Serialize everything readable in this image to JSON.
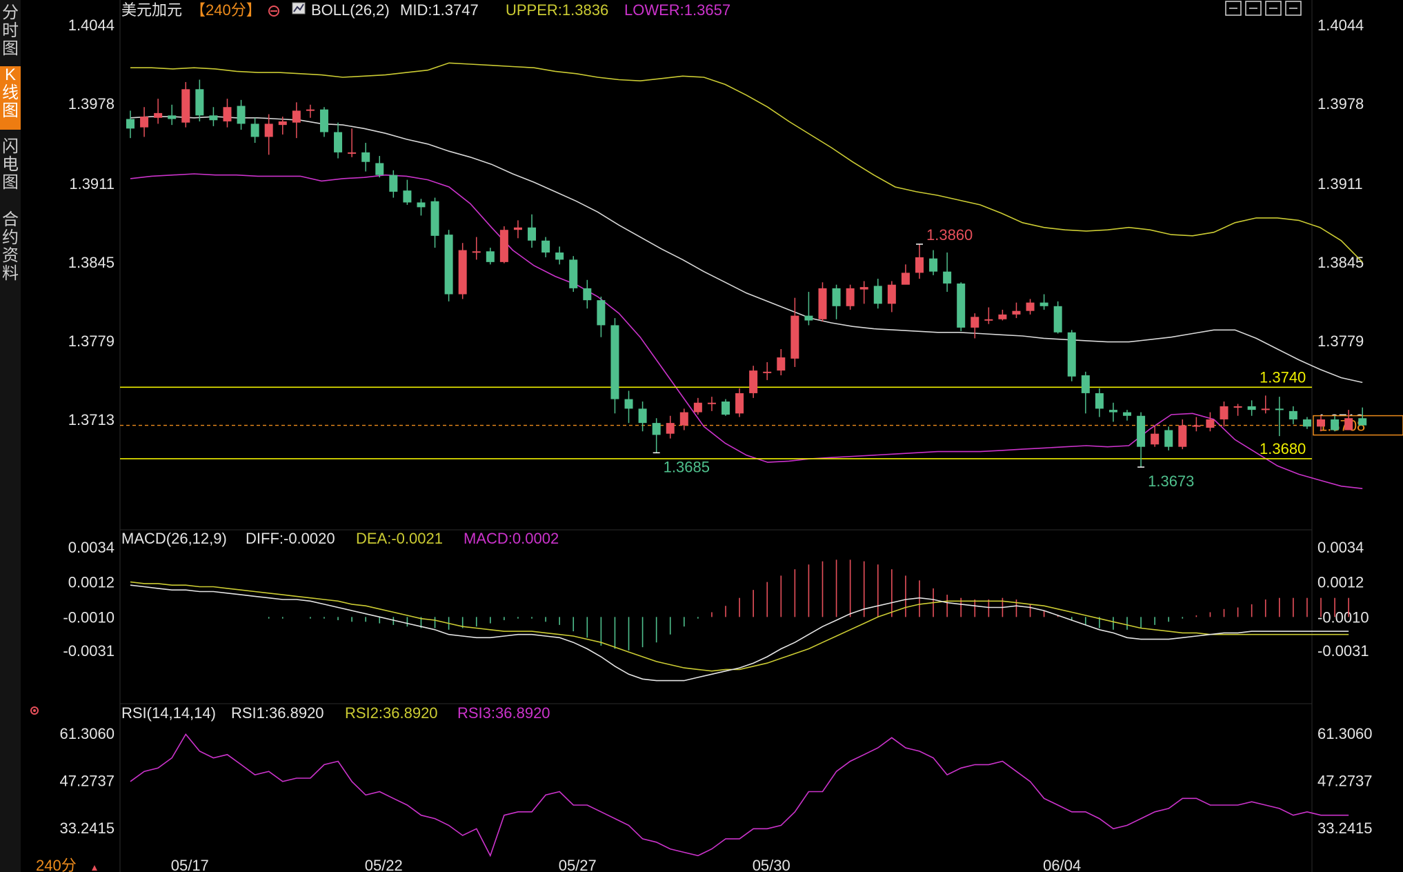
{
  "sidebar": {
    "tabs": [
      {
        "label": "分\n时\n图",
        "active": false
      },
      {
        "label": "K\n线\n图",
        "active": true
      },
      {
        "label": "闪\n电\n图",
        "active": false
      },
      {
        "label": "合\n约\n资\n料",
        "active": false
      }
    ]
  },
  "period_footer": "240分",
  "colors": {
    "up": "#e8505b",
    "down": "#4fc08d",
    "mid": "#d9d9d9",
    "upper": "#cccc33",
    "lower": "#cc33cc",
    "level": "#f0f000",
    "current": "#ee8c1c"
  },
  "toolbar_icons": [
    "fullscreen-icon",
    "layout-icon",
    "split-icon",
    "close-icon"
  ],
  "chart_data": [
    {
      "type": "candlestick",
      "symbol": "美元加元",
      "period": "【240分】",
      "indicator": "BOLL(26,2)",
      "legend": {
        "mid": "MID:1.3747",
        "upper": "UPPER:1.3836",
        "lower": "LOWER:1.3657"
      },
      "ylim": [
        1.3625,
        1.4044
      ],
      "y_ticks": [
        "1.4044",
        "1.3978",
        "1.3911",
        "1.3845",
        "1.3779",
        "1.3713"
      ],
      "x_ticks": [
        "05/17",
        "05/22",
        "05/27",
        "05/30",
        "06/04"
      ],
      "candles": [
        [
          1.3965,
          1.3957,
          1.3972,
          1.3949
        ],
        [
          1.3958,
          1.3967,
          1.3975,
          1.395
        ],
        [
          1.3966,
          1.397,
          1.3982,
          1.3961
        ],
        [
          1.3968,
          1.3965,
          1.3977,
          1.396
        ],
        [
          1.3962,
          1.399,
          1.3996,
          1.3958
        ],
        [
          1.399,
          1.3968,
          1.3998,
          1.3963
        ],
        [
          1.3968,
          1.3964,
          1.3975,
          1.3959
        ],
        [
          1.3963,
          1.3975,
          1.3982,
          1.3958
        ],
        [
          1.3976,
          1.3961,
          1.3981,
          1.3956
        ],
        [
          1.3961,
          1.395,
          1.3966,
          1.3945
        ],
        [
          1.395,
          1.3961,
          1.3969,
          1.3935
        ],
        [
          1.396,
          1.3963,
          1.3967,
          1.3952
        ],
        [
          1.3962,
          1.3972,
          1.3979,
          1.3949
        ],
        [
          1.3973,
          1.3973,
          1.3977,
          1.3966
        ],
        [
          1.3973,
          1.3954,
          1.3975,
          1.395
        ],
        [
          1.3954,
          1.3937,
          1.3962,
          1.3932
        ],
        [
          1.3937,
          1.3937,
          1.3957,
          1.3933
        ],
        [
          1.3937,
          1.3929,
          1.3945,
          1.3921
        ],
        [
          1.3928,
          1.3918,
          1.3934,
          1.3916
        ],
        [
          1.3918,
          1.3904,
          1.3922,
          1.3899
        ],
        [
          1.3905,
          1.3895,
          1.3914,
          1.3893
        ],
        [
          1.3895,
          1.3891,
          1.3898,
          1.3884
        ],
        [
          1.3896,
          1.3867,
          1.3899,
          1.3857
        ],
        [
          1.3868,
          1.3818,
          1.3872,
          1.3812
        ],
        [
          1.3818,
          1.3855,
          1.3861,
          1.3814
        ],
        [
          1.3854,
          1.3854,
          1.3866,
          1.3847
        ],
        [
          1.3854,
          1.3845,
          1.3857,
          1.3843
        ],
        [
          1.3845,
          1.3872,
          1.3875,
          1.3844
        ],
        [
          1.3872,
          1.3874,
          1.388,
          1.3865
        ],
        [
          1.3874,
          1.3863,
          1.3885,
          1.3857
        ],
        [
          1.3863,
          1.3853,
          1.3866,
          1.3849
        ],
        [
          1.3853,
          1.3847,
          1.3858,
          1.3843
        ],
        [
          1.3847,
          1.3823,
          1.385,
          1.382
        ],
        [
          1.3823,
          1.3813,
          1.383,
          1.3806
        ],
        [
          1.3813,
          1.3792,
          1.3816,
          1.3782
        ],
        [
          1.3792,
          1.373,
          1.3798,
          1.3718
        ],
        [
          1.373,
          1.3722,
          1.3737,
          1.371
        ],
        [
          1.3722,
          1.371,
          1.3728,
          1.3703
        ],
        [
          1.371,
          1.37,
          1.3714,
          1.3685
        ],
        [
          1.3701,
          1.371,
          1.3716,
          1.3697
        ],
        [
          1.3708,
          1.3719,
          1.3722,
          1.3704
        ],
        [
          1.3719,
          1.3727,
          1.3731,
          1.3717
        ],
        [
          1.3726,
          1.3727,
          1.3732,
          1.372
        ],
        [
          1.3728,
          1.3717,
          1.373,
          1.3716
        ],
        [
          1.3718,
          1.3735,
          1.3739,
          1.3715
        ],
        [
          1.3735,
          1.3754,
          1.3758,
          1.3731
        ],
        [
          1.3752,
          1.3753,
          1.3761,
          1.3746
        ],
        [
          1.3754,
          1.3765,
          1.3772,
          1.375
        ],
        [
          1.3764,
          1.38,
          1.3815,
          1.3757
        ],
        [
          1.38,
          1.3796,
          1.382,
          1.3792
        ],
        [
          1.3797,
          1.3823,
          1.3828,
          1.3795
        ],
        [
          1.3823,
          1.3808,
          1.3826,
          1.3797
        ],
        [
          1.3808,
          1.3823,
          1.3826,
          1.3805
        ],
        [
          1.3822,
          1.3824,
          1.3829,
          1.381
        ],
        [
          1.3825,
          1.381,
          1.3831,
          1.3806
        ],
        [
          1.381,
          1.3826,
          1.3829,
          1.3803
        ],
        [
          1.3826,
          1.3836,
          1.3843,
          1.3831
        ],
        [
          1.3836,
          1.3849,
          1.386,
          1.3831
        ],
        [
          1.3848,
          1.3837,
          1.3855,
          1.3834
        ],
        [
          1.3837,
          1.3827,
          1.3853,
          1.382
        ],
        [
          1.3827,
          1.379,
          1.3828,
          1.3787
        ],
        [
          1.379,
          1.3799,
          1.3802,
          1.3781
        ],
        [
          1.3797,
          1.3797,
          1.3807,
          1.3793
        ],
        [
          1.3797,
          1.3801,
          1.3805,
          1.3796
        ],
        [
          1.3801,
          1.3804,
          1.3811,
          1.3798
        ],
        [
          1.3804,
          1.3811,
          1.3814,
          1.3801
        ],
        [
          1.3811,
          1.3808,
          1.3818,
          1.3805
        ],
        [
          1.3808,
          1.3786,
          1.3812,
          1.3785
        ],
        [
          1.3786,
          1.3749,
          1.3788,
          1.3745
        ],
        [
          1.375,
          1.3735,
          1.3753,
          1.3718
        ],
        [
          1.3735,
          1.3722,
          1.3739,
          1.3715
        ],
        [
          1.3721,
          1.3719,
          1.3727,
          1.3711
        ],
        [
          1.3719,
          1.3716,
          1.3721,
          1.3712
        ],
        [
          1.3716,
          1.369,
          1.3719,
          1.3673
        ],
        [
          1.3692,
          1.3701,
          1.3708,
          1.369
        ],
        [
          1.3704,
          1.369,
          1.3707,
          1.3687
        ],
        [
          1.369,
          1.3708,
          1.3713,
          1.3688
        ],
        [
          1.3708,
          1.3708,
          1.3715,
          1.3703
        ],
        [
          1.3706,
          1.3713,
          1.3719,
          1.3703
        ],
        [
          1.3713,
          1.3724,
          1.3728,
          1.3707
        ],
        [
          1.3724,
          1.3724,
          1.3726,
          1.3716
        ],
        [
          1.3724,
          1.3721,
          1.3729,
          1.3716
        ],
        [
          1.3722,
          1.3722,
          1.3733,
          1.3718
        ],
        [
          1.3722,
          1.3721,
          1.3732,
          1.3699
        ],
        [
          1.372,
          1.3713,
          1.3724,
          1.3709
        ],
        [
          1.3713,
          1.3707,
          1.3715,
          1.3705
        ],
        [
          1.3707,
          1.3713,
          1.3716,
          1.3703
        ],
        [
          1.3713,
          1.3704,
          1.3716,
          1.3703
        ],
        [
          1.3704,
          1.3714,
          1.3721,
          1.3705
        ],
        [
          1.3714,
          1.3708,
          1.3723,
          1.3708
        ]
      ],
      "mid": [
        1.3966,
        1.3967,
        1.3967,
        1.3966,
        1.3967,
        1.3966,
        1.3966,
        1.3965,
        1.3964,
        1.3961,
        1.396,
        1.3957,
        1.3953,
        1.3948,
        1.3944,
        1.3938,
        1.3933,
        1.3927,
        1.3919,
        1.3912,
        1.3904,
        1.3896,
        1.3887,
        1.3876,
        1.3866,
        1.3856,
        1.3847,
        1.3837,
        1.3828,
        1.3819,
        1.3812,
        1.3805,
        1.3798,
        1.3794,
        1.3791,
        1.3789,
        1.3788,
        1.3787,
        1.3786,
        1.3786,
        1.3785,
        1.3784,
        1.3783,
        1.3781,
        1.378,
        1.3779,
        1.3778,
        1.3778,
        1.378,
        1.3782,
        1.3785,
        1.3788,
        1.3788,
        1.3781,
        1.3772,
        1.3763,
        1.3755,
        1.3748,
        1.3744
      ],
      "mid_start": 0,
      "upper": [
        1.4008,
        1.4008,
        1.4007,
        1.4008,
        1.4007,
        1.4005,
        1.4004,
        1.4004,
        1.4003,
        1.4002,
        1.4,
        1.4001,
        1.4002,
        1.4004,
        1.4006,
        1.4012,
        1.4011,
        1.401,
        1.4009,
        1.4008,
        1.4005,
        1.4003,
        1.4,
        1.3998,
        1.3997,
        1.3999,
        1.4001,
        1.4,
        1.3994,
        1.3985,
        1.3975,
        1.3963,
        1.3952,
        1.3941,
        1.3929,
        1.3918,
        1.3908,
        1.3904,
        1.3901,
        1.3897,
        1.3893,
        1.3886,
        1.3878,
        1.3874,
        1.3872,
        1.3871,
        1.3872,
        1.3874,
        1.3872,
        1.3868,
        1.3867,
        1.387,
        1.3878,
        1.3882,
        1.3882,
        1.388,
        1.3874,
        1.3863,
        1.3845
      ],
      "lower": [
        1.3915,
        1.3917,
        1.3918,
        1.3919,
        1.3918,
        1.3918,
        1.3917,
        1.3917,
        1.3917,
        1.3913,
        1.3915,
        1.3916,
        1.3918,
        1.3917,
        1.3914,
        1.3908,
        1.3894,
        1.3874,
        1.3855,
        1.3842,
        1.3833,
        1.3826,
        1.3816,
        1.3802,
        1.3782,
        1.3757,
        1.3732,
        1.3707,
        1.3693,
        1.3683,
        1.3677,
        1.3678,
        1.368,
        1.3681,
        1.3682,
        1.3683,
        1.3684,
        1.3685,
        1.3686,
        1.3686,
        1.3686,
        1.3687,
        1.3688,
        1.3689,
        1.369,
        1.3691,
        1.369,
        1.3691,
        1.3705,
        1.3717,
        1.3718,
        1.3713,
        1.3696,
        1.3685,
        1.3674,
        1.3667,
        1.3662,
        1.3657,
        1.3655
      ],
      "annotations": [
        {
          "text": "1.3860",
          "candle": 57,
          "position": "above"
        },
        {
          "text": "1.3685",
          "candle": 38,
          "position": "below"
        },
        {
          "text": "1.3673",
          "candle": 73,
          "position": "below"
        }
      ],
      "levels": [
        {
          "value": 1.374,
          "label": "1.3740"
        },
        {
          "value": 1.368,
          "label": "1.3680"
        }
      ],
      "current": {
        "value": 1.3708,
        "label": "1.3708"
      }
    },
    {
      "type": "bar+line",
      "indicator": "MACD(26,12,9)",
      "legend": {
        "diff": "DIFF:-0.0020",
        "dea": "DEA:-0.0021",
        "macd": "MACD:0.0002"
      },
      "ylim": [
        -0.0058,
        0.0037
      ],
      "y_ticks": [
        "0.0034",
        "0.0012",
        "-0.0010",
        "-0.0031"
      ],
      "diff": [
        0.001,
        0.0009,
        0.0008,
        0.0007,
        0.0007,
        0.0006,
        0.0006,
        0.0005,
        0.0004,
        0.0003,
        0.0002,
        0.0001,
        0.0001,
        0.0,
        -0.0002,
        -0.0004,
        -0.0006,
        -0.0008,
        -0.001,
        -0.0012,
        -0.0014,
        -0.0016,
        -0.0018,
        -0.0021,
        -0.0022,
        -0.0023,
        -0.0023,
        -0.0022,
        -0.0021,
        -0.0021,
        -0.0022,
        -0.0023,
        -0.0026,
        -0.003,
        -0.0035,
        -0.0041,
        -0.0046,
        -0.0049,
        -0.005,
        -0.005,
        -0.005,
        -0.0048,
        -0.0046,
        -0.0044,
        -0.0042,
        -0.0039,
        -0.0035,
        -0.003,
        -0.0026,
        -0.0021,
        -0.0016,
        -0.0012,
        -0.0008,
        -0.0005,
        -0.0003,
        -0.0001,
        0.0001,
        0.0002,
        0.0001,
        -0.0001,
        -0.0002,
        -0.0003,
        -0.0004,
        -0.0004,
        -0.0003,
        -0.0004,
        -0.0006,
        -0.0009,
        -0.0012,
        -0.0015,
        -0.0018,
        -0.002,
        -0.0023,
        -0.0024,
        -0.0024,
        -0.0024,
        -0.0023,
        -0.0022,
        -0.0021,
        -0.002,
        -0.002,
        -0.0019,
        -0.0019,
        -0.0019,
        -0.0019,
        -0.0019,
        -0.0019,
        -0.0019,
        -0.0019
      ],
      "dea": [
        0.0012,
        0.0011,
        0.0011,
        0.001,
        0.001,
        0.0009,
        0.0009,
        0.0008,
        0.0007,
        0.0006,
        0.0005,
        0.0004,
        0.0003,
        0.0002,
        0.0001,
        0.0,
        -0.0002,
        -0.0003,
        -0.0005,
        -0.0007,
        -0.0009,
        -0.0011,
        -0.0012,
        -0.0014,
        -0.0016,
        -0.0017,
        -0.0018,
        -0.0019,
        -0.0019,
        -0.0019,
        -0.002,
        -0.0021,
        -0.0022,
        -0.0024,
        -0.0026,
        -0.0029,
        -0.0032,
        -0.0035,
        -0.0038,
        -0.004,
        -0.0042,
        -0.0043,
        -0.0044,
        -0.0043,
        -0.0043,
        -0.0041,
        -0.0039,
        -0.0036,
        -0.0033,
        -0.003,
        -0.0026,
        -0.0022,
        -0.0018,
        -0.0014,
        -0.001,
        -0.0007,
        -0.0004,
        -0.0002,
        -0.0001,
        0.0,
        0.0,
        0.0,
        0.0,
        0.0,
        -0.0001,
        -0.0002,
        -0.0003,
        -0.0005,
        -0.0007,
        -0.0009,
        -0.0011,
        -0.0013,
        -0.0015,
        -0.0017,
        -0.0018,
        -0.0019,
        -0.002,
        -0.002,
        -0.0021,
        -0.0021,
        -0.0021,
        -0.0021,
        -0.0021,
        -0.0021,
        -0.0021,
        -0.0021,
        -0.0021,
        -0.0021,
        -0.0021
      ],
      "macd": [
        -0.001,
        -0.001,
        -0.001,
        -0.001,
        -0.001,
        -0.001,
        -0.001,
        -0.001,
        -0.001,
        -0.001,
        -0.0011,
        -0.0011,
        -0.001,
        -0.0011,
        -0.0011,
        -0.0012,
        -0.0013,
        -0.0013,
        -0.0014,
        -0.0015,
        -0.0016,
        -0.0017,
        -0.0017,
        -0.0018,
        -0.0017,
        -0.0016,
        -0.0014,
        -0.0012,
        -0.0011,
        -0.0011,
        -0.0013,
        -0.0015,
        -0.0019,
        -0.0023,
        -0.0028,
        -0.003,
        -0.0031,
        -0.0029,
        -0.0026,
        -0.0021,
        -0.0016,
        -0.0011,
        -0.0007,
        -0.0003,
        0.0002,
        0.0007,
        0.0012,
        0.0016,
        0.002,
        0.0023,
        0.0025,
        0.0026,
        0.0026,
        0.0025,
        0.0023,
        0.002,
        0.0016,
        0.0013,
        0.0008,
        0.0004,
        0.0002,
        0.0001,
        0.0001,
        0.0002,
        0.0001,
        -0.0002,
        -0.0006,
        -0.0009,
        -0.0012,
        -0.0015,
        -0.0017,
        -0.0018,
        -0.0018,
        -0.0017,
        -0.0015,
        -0.0013,
        -0.0011,
        -0.0009,
        -0.0007,
        -0.0005,
        -0.0004,
        -0.0002,
        0.0001,
        0.0002,
        0.0002,
        0.0002,
        0.0002,
        0.0002,
        0.0002
      ],
      "macd_zero": -0.001
    },
    {
      "type": "line",
      "indicator": "RSI(14,14,14)",
      "legend": {
        "rsi1": "RSI1:36.8920",
        "rsi2": "RSI2:36.8920",
        "rsi3": "RSI3:36.8920"
      },
      "ylim": [
        22.0,
        66.0
      ],
      "y_ticks": [
        "61.3060",
        "47.2737",
        "33.2415"
      ],
      "rsi": [
        47,
        50,
        51,
        54,
        61,
        56,
        54,
        55,
        52,
        49,
        50,
        47,
        48,
        48,
        52,
        53,
        47,
        43,
        44,
        42,
        40,
        37,
        36,
        34,
        31,
        33,
        25,
        37,
        38,
        38,
        43,
        44,
        40,
        40,
        38,
        36,
        34,
        30,
        29,
        27,
        26,
        25,
        27,
        30,
        30,
        33,
        33,
        34,
        38,
        44,
        44,
        50,
        53,
        55,
        57,
        60,
        57,
        56,
        54,
        49,
        51,
        52,
        52,
        53,
        50,
        47,
        42,
        40,
        38,
        38,
        36,
        33,
        34,
        36,
        38,
        39,
        42,
        42,
        40,
        40,
        40,
        41,
        40,
        39,
        37,
        38,
        37,
        37,
        37
      ]
    }
  ]
}
